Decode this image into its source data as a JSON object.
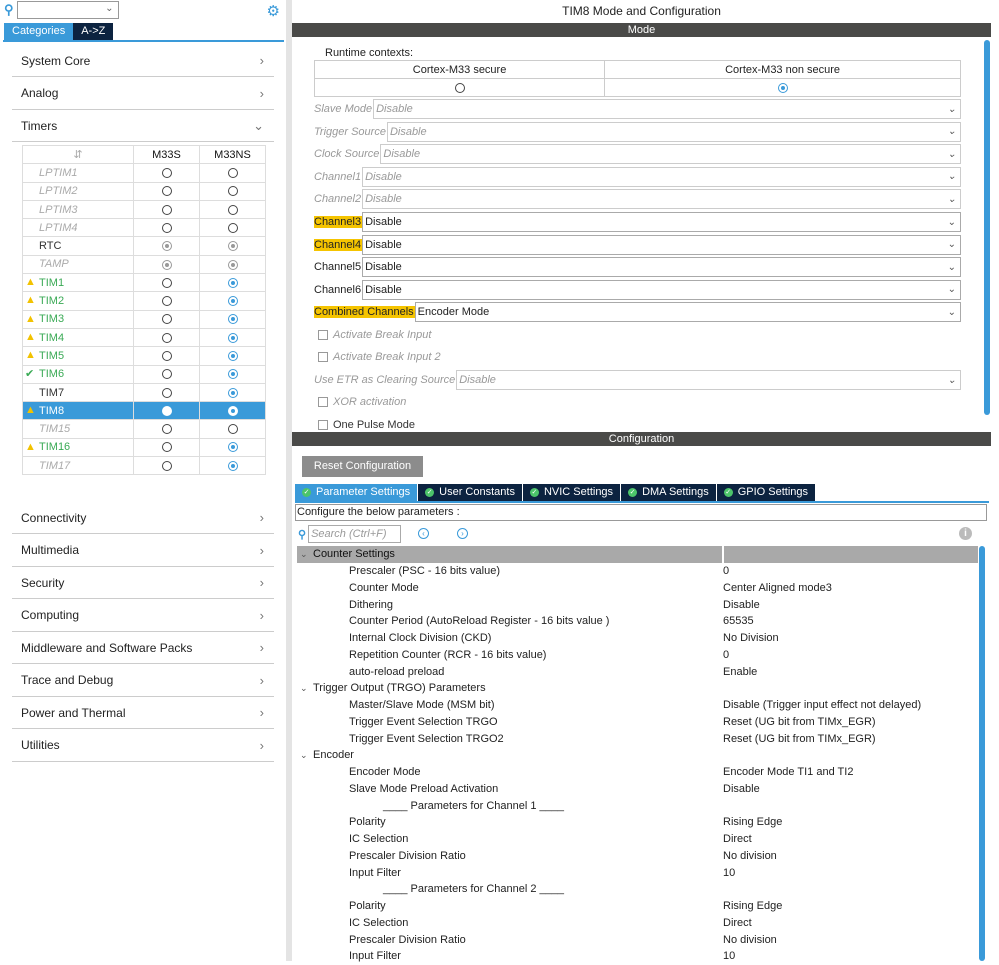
{
  "left": {
    "tabs": [
      "Categories",
      "A->Z"
    ],
    "categories_top": [
      "System Core",
      "Analog",
      "Timers"
    ],
    "table_headers": [
      "",
      "M33S",
      "M33NS"
    ],
    "timers": [
      {
        "name": "LPTIM1",
        "style": "dis",
        "s": "off",
        "ns": "off",
        "icon": ""
      },
      {
        "name": "LPTIM2",
        "style": "dis",
        "s": "off",
        "ns": "off",
        "icon": ""
      },
      {
        "name": "LPTIM3",
        "style": "dis",
        "s": "off",
        "ns": "off",
        "icon": ""
      },
      {
        "name": "LPTIM4",
        "style": "dis",
        "s": "off",
        "ns": "off",
        "icon": ""
      },
      {
        "name": "RTC",
        "style": "norm",
        "s": "grey",
        "ns": "grey",
        "icon": ""
      },
      {
        "name": "TAMP",
        "style": "dis",
        "s": "grey",
        "ns": "grey",
        "icon": ""
      },
      {
        "name": "TIM1",
        "style": "green",
        "s": "off",
        "ns": "on",
        "icon": "warning"
      },
      {
        "name": "TIM2",
        "style": "green",
        "s": "off",
        "ns": "on",
        "icon": "warning"
      },
      {
        "name": "TIM3",
        "style": "green",
        "s": "off",
        "ns": "on",
        "icon": "warning"
      },
      {
        "name": "TIM4",
        "style": "green",
        "s": "off",
        "ns": "on",
        "icon": "warning"
      },
      {
        "name": "TIM5",
        "style": "green",
        "s": "off",
        "ns": "on",
        "icon": "warning"
      },
      {
        "name": "TIM6",
        "style": "green",
        "s": "off",
        "ns": "on",
        "icon": "check"
      },
      {
        "name": "TIM7",
        "style": "norm",
        "s": "off",
        "ns": "on",
        "icon": ""
      },
      {
        "name": "TIM8",
        "style": "selected",
        "s": "off",
        "ns": "on",
        "icon": "warning"
      },
      {
        "name": "TIM15",
        "style": "dis",
        "s": "off",
        "ns": "off",
        "icon": ""
      },
      {
        "name": "TIM16",
        "style": "green",
        "s": "off",
        "ns": "on",
        "icon": "warning"
      },
      {
        "name": "TIM17",
        "style": "dis",
        "s": "off",
        "ns": "on",
        "icon": ""
      }
    ],
    "categories_bottom": [
      "Connectivity",
      "Multimedia",
      "Security",
      "Computing",
      "Middleware and Software Packs",
      "Trace and Debug",
      "Power and Thermal",
      "Utilities"
    ]
  },
  "right": {
    "title": "TIM8 Mode and Configuration",
    "mode_header": "Mode",
    "runtime_label": "Runtime contexts:",
    "contexts": [
      {
        "label": "Cortex-M33 secure",
        "selected": false
      },
      {
        "label": "Cortex-M33 non secure",
        "selected": true
      }
    ],
    "mode_rows": [
      {
        "label": "Slave Mode",
        "value": "Disable",
        "enabled": false,
        "highlight": false
      },
      {
        "label": "Trigger Source",
        "value": "Disable",
        "enabled": false,
        "highlight": false
      },
      {
        "label": "Clock Source",
        "value": "Disable",
        "enabled": false,
        "highlight": false
      },
      {
        "label": "Channel1",
        "value": "Disable",
        "enabled": false,
        "highlight": false
      },
      {
        "label": "Channel2",
        "value": "Disable",
        "enabled": false,
        "highlight": false
      },
      {
        "label": "Channel3",
        "value": "Disable",
        "enabled": true,
        "highlight": true
      },
      {
        "label": "Channel4",
        "value": "Disable",
        "enabled": true,
        "highlight": true
      },
      {
        "label": "Channel5",
        "value": "Disable",
        "enabled": true,
        "highlight": false
      },
      {
        "label": "Channel6",
        "value": "Disable",
        "enabled": true,
        "highlight": false
      },
      {
        "label": "Combined Channels",
        "value": "Encoder Mode",
        "enabled": true,
        "highlight": true
      }
    ],
    "checkbox_1": "Activate Break Input",
    "checkbox_2": "Activate Break Input 2",
    "etr_label": "Use ETR as Clearing Source",
    "etr_value": "Disable",
    "checkbox_3": "XOR activation",
    "checkbox_4": "One Pulse Mode",
    "config_header": "Configuration",
    "reset_label": "Reset Configuration",
    "tabs": [
      "Parameter Settings",
      "User Constants",
      "NVIC Settings",
      "DMA Settings",
      "GPIO Settings"
    ],
    "configure_text": "Configure the below parameters :",
    "search_placeholder": "Search (Ctrl+F)",
    "tree": [
      {
        "type": "group",
        "label": "Counter Settings",
        "value": ""
      },
      {
        "type": "param",
        "label": "Prescaler (PSC - 16 bits value)",
        "value": "0"
      },
      {
        "type": "param",
        "label": "Counter Mode",
        "value": "Center Aligned mode3"
      },
      {
        "type": "param",
        "label": "Dithering",
        "value": "Disable"
      },
      {
        "type": "param",
        "label": "Counter Period (AutoReload Register - 16 bits value )",
        "value": "65535"
      },
      {
        "type": "param",
        "label": "Internal Clock Division (CKD)",
        "value": "No Division"
      },
      {
        "type": "param",
        "label": "Repetition Counter (RCR - 16 bits value)",
        "value": "0"
      },
      {
        "type": "param",
        "label": "auto-reload preload",
        "value": "Enable"
      },
      {
        "type": "head2",
        "label": "Trigger Output (TRGO) Parameters",
        "value": ""
      },
      {
        "type": "param",
        "label": "Master/Slave Mode (MSM bit)",
        "value": "Disable (Trigger input effect not delayed)"
      },
      {
        "type": "param",
        "label": "Trigger Event Selection TRGO",
        "value": "Reset (UG bit from TIMx_EGR)"
      },
      {
        "type": "param",
        "label": "Trigger Event Selection TRGO2",
        "value": "Reset (UG bit from TIMx_EGR)"
      },
      {
        "type": "head2",
        "label": "Encoder",
        "value": ""
      },
      {
        "type": "param",
        "label": "Encoder Mode",
        "value": "Encoder Mode TI1 and TI2"
      },
      {
        "type": "param",
        "label": "Slave Mode Preload Activation",
        "value": "Disable"
      },
      {
        "type": "sub",
        "label": "____ Parameters for Channel 1 ____",
        "value": ""
      },
      {
        "type": "param",
        "label": "Polarity",
        "value": "Rising Edge"
      },
      {
        "type": "param",
        "label": "IC Selection",
        "value": "Direct"
      },
      {
        "type": "param",
        "label": "Prescaler Division Ratio",
        "value": "No division"
      },
      {
        "type": "param",
        "label": "Input Filter",
        "value": "10"
      },
      {
        "type": "sub",
        "label": "____ Parameters for Channel 2 ____",
        "value": ""
      },
      {
        "type": "param",
        "label": "Polarity",
        "value": "Rising Edge"
      },
      {
        "type": "param",
        "label": "IC Selection",
        "value": "Direct"
      },
      {
        "type": "param",
        "label": "Prescaler Division Ratio",
        "value": "No division"
      },
      {
        "type": "param",
        "label": "Input Filter",
        "value": "10"
      }
    ]
  },
  "colors": {
    "accent": "#3a9ad9",
    "dark_tab": "#0c2340",
    "header_bar": "#4a4a48",
    "highlight": "#f5c400",
    "ok_green": "#3aaa55",
    "warning": "#f2c200"
  }
}
